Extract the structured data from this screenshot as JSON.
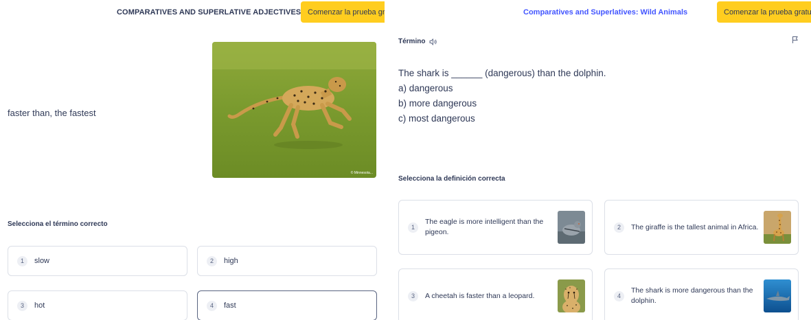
{
  "left": {
    "title": "COMPARATIVES AND SUPERLATIVE ADJECTIVES",
    "cta_label": "Comenzar la prueba gratuita",
    "definition": "faster than, the fastest",
    "prompt": "Selecciona el término correcto",
    "options": [
      {
        "num": "1",
        "label": "slow"
      },
      {
        "num": "2",
        "label": "high"
      },
      {
        "num": "3",
        "label": "hot"
      },
      {
        "num": "4",
        "label": "fast"
      }
    ],
    "photo_credit": "© Minnesota..."
  },
  "right": {
    "title": "Comparatives and Superlatives: Wild Animals",
    "cta_label": "Comenzar la prueba gratuita",
    "term_label": "Término",
    "question": "The shark is ______ (dangerous) than the dolphin.",
    "answers": [
      "a) dangerous",
      "b) more dangerous",
      "c) most dangerous"
    ],
    "prompt": "Selecciona la definición correcta",
    "options": [
      {
        "num": "1",
        "text": "The eagle is more intelligent than the pigeon.",
        "image": "pigeon"
      },
      {
        "num": "2",
        "text": "The giraffe is the tallest animal in Africa.",
        "image": "giraffe"
      },
      {
        "num": "3",
        "text": "A cheetah is faster than a leopard.",
        "image": "cheetah"
      },
      {
        "num": "4",
        "text": "The shark is more dangerous than the dolphin.",
        "image": "shark"
      }
    ]
  },
  "colors": {
    "accent": "#4255ff",
    "cta": "#ffcd1f",
    "text": "#2e3856",
    "border": "#dbdfe7"
  }
}
